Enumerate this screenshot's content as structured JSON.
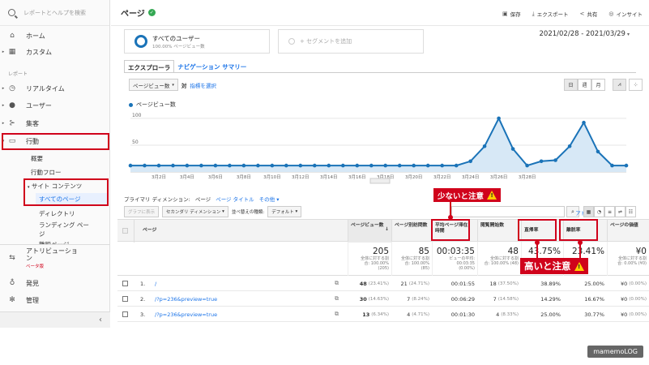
{
  "sidebar": {
    "search_placeholder": "レポートとヘルプを検索",
    "home": "ホーム",
    "custom": "カスタム",
    "reports_label": "レポート",
    "realtime": "リアルタイム",
    "user": "ユーザー",
    "acquisition": "集客",
    "behavior": "行動",
    "overview": "概要",
    "behavior_flow": "行動フロー",
    "site_content": "サイト コンテンツ",
    "all_pages": "すべてのページ",
    "directory": "ディレクトリ",
    "landing_page_1": "ランディング ペー",
    "landing_page_2": "ジ",
    "exit_page": "離脱ページ",
    "attribution_1": "アトリビューショ",
    "attribution_2": "ン",
    "beta": "ベータ版",
    "discover": "発見",
    "admin": "管理",
    "collapse": "‹"
  },
  "header": {
    "title": "ページ",
    "save": "保存",
    "export": "エクスポート",
    "share": "共有",
    "insights": "インサイト"
  },
  "segments": {
    "all_users": "すべてのユーザー",
    "all_users_sub": "100.00% ページビュー数",
    "add_segment": "+ セグメントを追加"
  },
  "date_range": "2021/02/28 - 2021/03/29",
  "tabs": {
    "explorer": "エクスプローラ",
    "nav_summary": "ナビゲーション サマリー"
  },
  "controls": {
    "metric": "ページビュー数",
    "vs": "対",
    "select_metric": "指標を選択",
    "day": "日",
    "week": "週",
    "month": "月"
  },
  "chart_data": {
    "type": "area",
    "series": [
      {
        "name": "ページビュー数",
        "values": [
          12,
          12,
          12,
          12,
          12,
          12,
          12,
          12,
          12,
          12,
          12,
          12,
          12,
          12,
          12,
          12,
          12,
          12,
          12,
          12,
          12,
          12,
          12,
          12,
          20,
          48,
          100,
          43,
          12,
          20,
          22,
          48,
          92,
          38,
          12,
          12
        ]
      }
    ],
    "y_ticks": [
      "100",
      "50"
    ],
    "x_labels": [
      "3月2日",
      "3月4日",
      "3月6日",
      "3月8日",
      "3月10日",
      "3月12日",
      "3月14日",
      "3月16日",
      "3月18日",
      "3月20日",
      "3月22日",
      "3月24日",
      "3月26日",
      "3月28日"
    ],
    "ylim": [
      0,
      115
    ],
    "color": "#1a73b8",
    "grid": true
  },
  "dimension": {
    "label": "プライマリ ディメンション:",
    "current": "ページ",
    "page_title": "ページ タイトル",
    "other": "その他"
  },
  "filters": {
    "graph": "グラフに表示",
    "secondary": "セカンダリ ディメンション",
    "sort_type": "並べ替えの種類:",
    "default": "デフォルト",
    "advanced": "アドバンス"
  },
  "table": {
    "headers": {
      "page": "ページ",
      "pageviews": "ページビュー数",
      "unique": "ページ別訪問数",
      "avg_time_1": "平均ページ滞在",
      "avg_time_2": "時間",
      "entrances": "閲覧開始数",
      "bounce": "直帰率",
      "exit": "離脱率",
      "value": "ページの価値"
    },
    "totals": {
      "pageviews": "205",
      "pageviews_sub1": "全体に対する割",
      "pageviews_sub2": "合: 100.00%",
      "pageviews_sub3": "(205)",
      "unique": "85",
      "unique_sub1": "全体に対する割",
      "unique_sub2": "合: 100.00%",
      "unique_sub3": "(85)",
      "avg_time": "00:03:35",
      "avg_time_sub1": "ビューの平均:",
      "avg_time_sub2": "00:03:35",
      "avg_time_sub3": "(0.00%)",
      "entrances": "48",
      "entrances_sub1": "全体に対する割",
      "entrances_sub2": "合: 100.00% (48)",
      "bounce": "43.75%",
      "exit": "23.41%",
      "value": "¥0",
      "value_sub1": "全体に対する割",
      "value_sub2": "合: 0.00% (¥0)"
    },
    "rows": [
      {
        "idx": "1.",
        "page": "/",
        "pv": "48",
        "pv_pct": "(23.41%)",
        "uv": "21",
        "uv_pct": "(24.71%)",
        "time": "00:01:55",
        "ent": "18",
        "ent_pct": "(37.50%)",
        "bounce": "38.89%",
        "exit": "25.00%",
        "val": "¥0",
        "val_pct": "(0.00%)"
      },
      {
        "idx": "2.",
        "page": "/?p=236&preview=true",
        "pv": "30",
        "pv_pct": "(14.63%)",
        "uv": "7",
        "uv_pct": "(8.24%)",
        "time": "00:06:29",
        "ent": "7",
        "ent_pct": "(14.58%)",
        "bounce": "14.29%",
        "exit": "16.67%",
        "val": "¥0",
        "val_pct": "(0.00%)"
      },
      {
        "idx": "3.",
        "page": "/?p=236&preview=true",
        "pv": "13",
        "pv_pct": "(6.34%)",
        "uv": "4",
        "uv_pct": "(4.71%)",
        "time": "00:01:30",
        "ent": "4",
        "ent_pct": "(8.33%)",
        "bounce": "25.00%",
        "exit": "30.77%",
        "val": "¥0",
        "val_pct": "(0.00%)"
      }
    ]
  },
  "annotations": {
    "few_caution": "少ないと注意",
    "high_caution": "高いと注意"
  },
  "watermark": "mamemoLOG"
}
